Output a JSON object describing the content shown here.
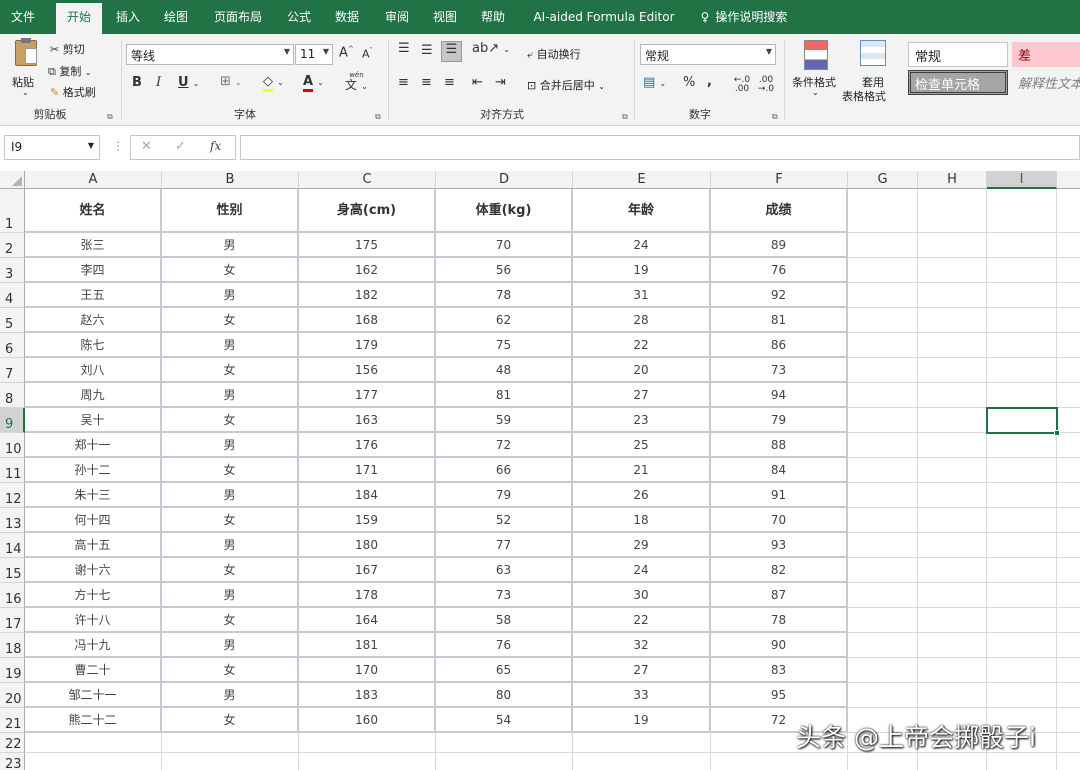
{
  "ribbon_tabs": [
    "文件",
    "开始",
    "插入",
    "绘图",
    "页面布局",
    "公式",
    "数据",
    "审阅",
    "视图",
    "帮助",
    "AI-aided Formula Editor",
    "操作说明搜索"
  ],
  "clipboard": {
    "paste": "粘贴",
    "cut": "剪切",
    "copy": "复制",
    "format_painter": "格式刷",
    "group": "剪贴板"
  },
  "font": {
    "name": "等线",
    "size": "11",
    "grow": "A",
    "shrink": "A",
    "bold": "B",
    "italic": "I",
    "underline": "U",
    "font_color": "A",
    "phonetic_top": "wén",
    "phonetic": "文",
    "group": "字体"
  },
  "alignment": {
    "wrap": "自动换行",
    "merge": "合并后居中",
    "group": "对齐方式"
  },
  "number": {
    "format": "常规",
    "percent": "%",
    "comma": ",",
    "inc": "←.0 .00",
    "dec": ".00 →.0",
    "group": "数字"
  },
  "styles": {
    "conditional": "条件格式",
    "table_top": "套用",
    "table_bottom": "表格格式",
    "normal": "常规",
    "bad": "差",
    "check_cell": "检查单元格",
    "explanatory": "解释性文本"
  },
  "formula_bar": {
    "name_box": "I9",
    "cancel": "✕",
    "enter": "✓",
    "fx": "fx",
    "value": ""
  },
  "columns": [
    "A",
    "B",
    "C",
    "D",
    "E",
    "F",
    "G",
    "H",
    "I"
  ],
  "selected_cell": "I9",
  "headers": [
    "姓名",
    "性别",
    "身高(cm)",
    "体重(kg)",
    "年龄",
    "成绩"
  ],
  "rows": [
    [
      "张三",
      "男",
      "175",
      "70",
      "24",
      "89"
    ],
    [
      "李四",
      "女",
      "162",
      "56",
      "19",
      "76"
    ],
    [
      "王五",
      "男",
      "182",
      "78",
      "31",
      "92"
    ],
    [
      "赵六",
      "女",
      "168",
      "62",
      "28",
      "81"
    ],
    [
      "陈七",
      "男",
      "179",
      "75",
      "22",
      "86"
    ],
    [
      "刘八",
      "女",
      "156",
      "48",
      "20",
      "73"
    ],
    [
      "周九",
      "男",
      "177",
      "81",
      "27",
      "94"
    ],
    [
      "吴十",
      "女",
      "163",
      "59",
      "23",
      "79"
    ],
    [
      "郑十一",
      "男",
      "176",
      "72",
      "25",
      "88"
    ],
    [
      "孙十二",
      "女",
      "171",
      "66",
      "21",
      "84"
    ],
    [
      "朱十三",
      "男",
      "184",
      "79",
      "26",
      "91"
    ],
    [
      "何十四",
      "女",
      "159",
      "52",
      "18",
      "70"
    ],
    [
      "高十五",
      "男",
      "180",
      "77",
      "29",
      "93"
    ],
    [
      "谢十六",
      "女",
      "167",
      "63",
      "24",
      "82"
    ],
    [
      "方十七",
      "男",
      "178",
      "73",
      "30",
      "87"
    ],
    [
      "许十八",
      "女",
      "164",
      "58",
      "22",
      "78"
    ],
    [
      "冯十九",
      "男",
      "181",
      "76",
      "32",
      "90"
    ],
    [
      "曹二十",
      "女",
      "170",
      "65",
      "27",
      "83"
    ],
    [
      "邹二十一",
      "男",
      "183",
      "80",
      "33",
      "95"
    ],
    [
      "熊二十二",
      "女",
      "160",
      "54",
      "19",
      "72"
    ]
  ],
  "row_numbers": [
    "1",
    "2",
    "3",
    "4",
    "5",
    "6",
    "7",
    "8",
    "9",
    "10",
    "11",
    "12",
    "13",
    "14",
    "15",
    "16",
    "17",
    "18",
    "19",
    "20",
    "21",
    "22",
    "23"
  ],
  "watermark": "头条 @上帝会掷骰子i",
  "colors": {
    "excel_green": "#217346",
    "bad_fill": "#ffc7ce",
    "bad_text": "#9c0006",
    "check_fill": "#a5a5a5"
  }
}
